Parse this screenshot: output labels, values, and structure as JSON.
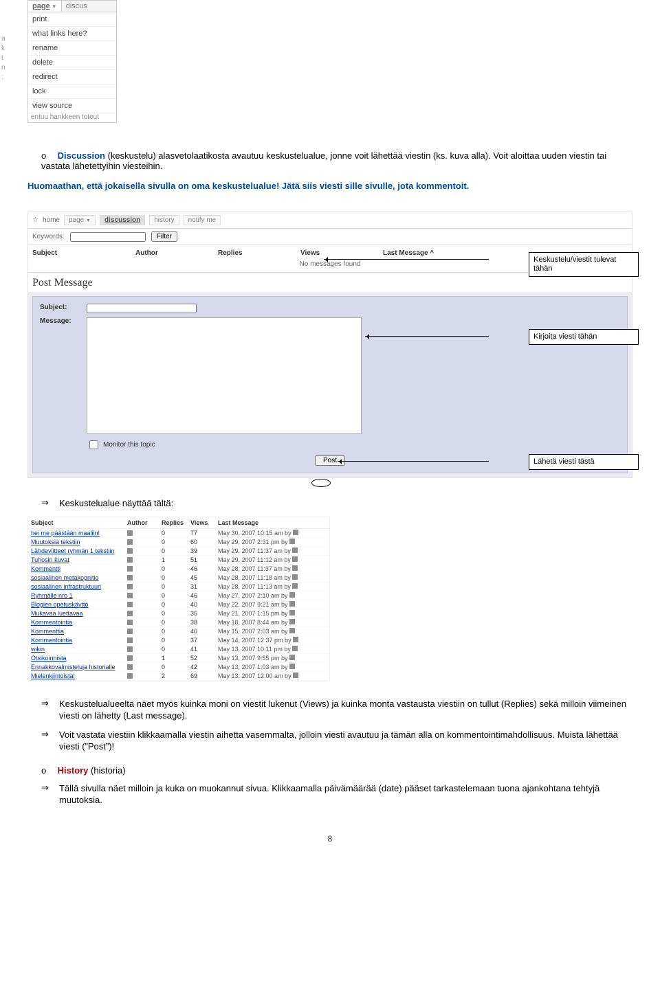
{
  "menu": {
    "page_tab": "page",
    "discuss_tab": "discus",
    "letters": [
      "a",
      "k",
      "t",
      "n",
      ":"
    ],
    "items": [
      "print",
      "what links here?",
      "rename",
      "delete",
      "redirect",
      "lock",
      "view source"
    ],
    "truncated": "entuu hankkeen toteut"
  },
  "para1_prefix": "o",
  "para1_lead": "Discussion",
  "para1_tail": " (keskustelu) alasvetolaatikosta avautuu keskustelualue, jonne voit lähettää viestin (ks. kuva alla). Voit aloittaa uuden viestin tai vastata lähetettyihin viesteihin.",
  "note": "Huomaathan, että jokaisella sivulla on oma keskustelualue! Jätä siis viesti sille sivulle, jota kommentoit.",
  "disc": {
    "home": "home",
    "tab_page": "page",
    "tab_discuss": "discussion",
    "tab_history": "history",
    "tab_notify": "notify me",
    "keywords_label": "Keywords:",
    "filter": "Filter",
    "cols": {
      "subject": "Subject",
      "author": "Author",
      "replies": "Replies",
      "views": "Views",
      "last": "Last Message"
    },
    "no_msg": "No messages found",
    "post_message": "Post Message",
    "subject_label": "Subject:",
    "message_label": "Message:",
    "monitor": "Monitor this topic",
    "post_btn": "Post"
  },
  "callouts": {
    "c1": "Keskustelu/viestit tulevat tähän",
    "c2": "Kirjoita viesti tähän",
    "c3": "Lähetä viesti tästä"
  },
  "section2_title": "Keskustelualue näyttää tältä:",
  "table": {
    "head": {
      "subject": "Subject",
      "author": "Author",
      "replies": "Replies",
      "views": "Views",
      "last": "Last Message"
    },
    "rows": [
      {
        "s": "hei me päästään maaliin!",
        "r": "0",
        "v": "77",
        "l": "May 30, 2007 10:15 am by"
      },
      {
        "s": "Muutoksia tekstiin",
        "r": "0",
        "v": "60",
        "l": "May 29, 2007 2:31 pm by"
      },
      {
        "s": "Lähdeviitteet ryhmän 1 tekstiin",
        "r": "0",
        "v": "39",
        "l": "May 29, 2007 11:37 am by"
      },
      {
        "s": "Tuhosin kuvat",
        "r": "1",
        "v": "51",
        "l": "May 29, 2007 11:12 am by"
      },
      {
        "s": "Kommentti",
        "r": "0",
        "v": "46",
        "l": "May 28, 2007 11:37 am by"
      },
      {
        "s": "sosiaalinen metakognitio",
        "r": "0",
        "v": "45",
        "l": "May 28, 2007 11:18 am by"
      },
      {
        "s": "sosiaalinen infrastruktuuri",
        "r": "0",
        "v": "31",
        "l": "May 28, 2007 11:13 am by"
      },
      {
        "s": "Ryhmälle nro 1",
        "r": "0",
        "v": "46",
        "l": "May 27, 2007 2:10 am by"
      },
      {
        "s": "Blogien opetuskäyttö",
        "r": "0",
        "v": "40",
        "l": "May 22, 2007 9:21 am by"
      },
      {
        "s": "Mukavaa luettavaa",
        "r": "0",
        "v": "35",
        "l": "May 21, 2007 1:15 pm by"
      },
      {
        "s": "Kommentointia",
        "r": "0",
        "v": "38",
        "l": "May 18, 2007 8:44 am by"
      },
      {
        "s": "Kommenttia",
        "r": "0",
        "v": "40",
        "l": "May 15, 2007 2:03 am by"
      },
      {
        "s": "Kommentointia",
        "r": "0",
        "v": "37",
        "l": "May 14, 2007 12:37 pm by"
      },
      {
        "s": "wikin",
        "r": "0",
        "v": "41",
        "l": "May 13, 2007 10:11 pm by"
      },
      {
        "s": "Otsikoinnista",
        "r": "1",
        "v": "52",
        "l": "May 13, 2007 9:55 pm by"
      },
      {
        "s": "Ennakkovalmisteluja historialle",
        "r": "0",
        "v": "42",
        "l": "May 13, 2007 1:03 am by"
      },
      {
        "s": "Mielenkiintoista!",
        "r": "2",
        "v": "69",
        "l": "May 13, 2007 12:00 am by"
      }
    ]
  },
  "after_table": {
    "p1": "Keskustelualueelta näet myös kuinka moni on viestit lukenut (Views) ja kuinka monta vastausta viestiin on tullut (Replies) sekä milloin viimeinen viesti on lähetty (Last message).",
    "p2": "Voit vastata viestiin klikkaamalla viestin aihetta vasemmalta, jolloin viesti avautuu ja tämän alla on kommentointimahdollisuus. Muista lähettää viesti (”Post”)!"
  },
  "history": {
    "prefix": "o",
    "lead": "History",
    "paren": " (historia)",
    "p": "Tällä sivulla näet milloin ja kuka on muokannut sivua. Klikkaamalla päivämäärää (date) pääset tarkastelemaan tuona ajankohtana tehtyjä muutoksia."
  },
  "glyph_arrow": "⇒",
  "page_number": "8"
}
